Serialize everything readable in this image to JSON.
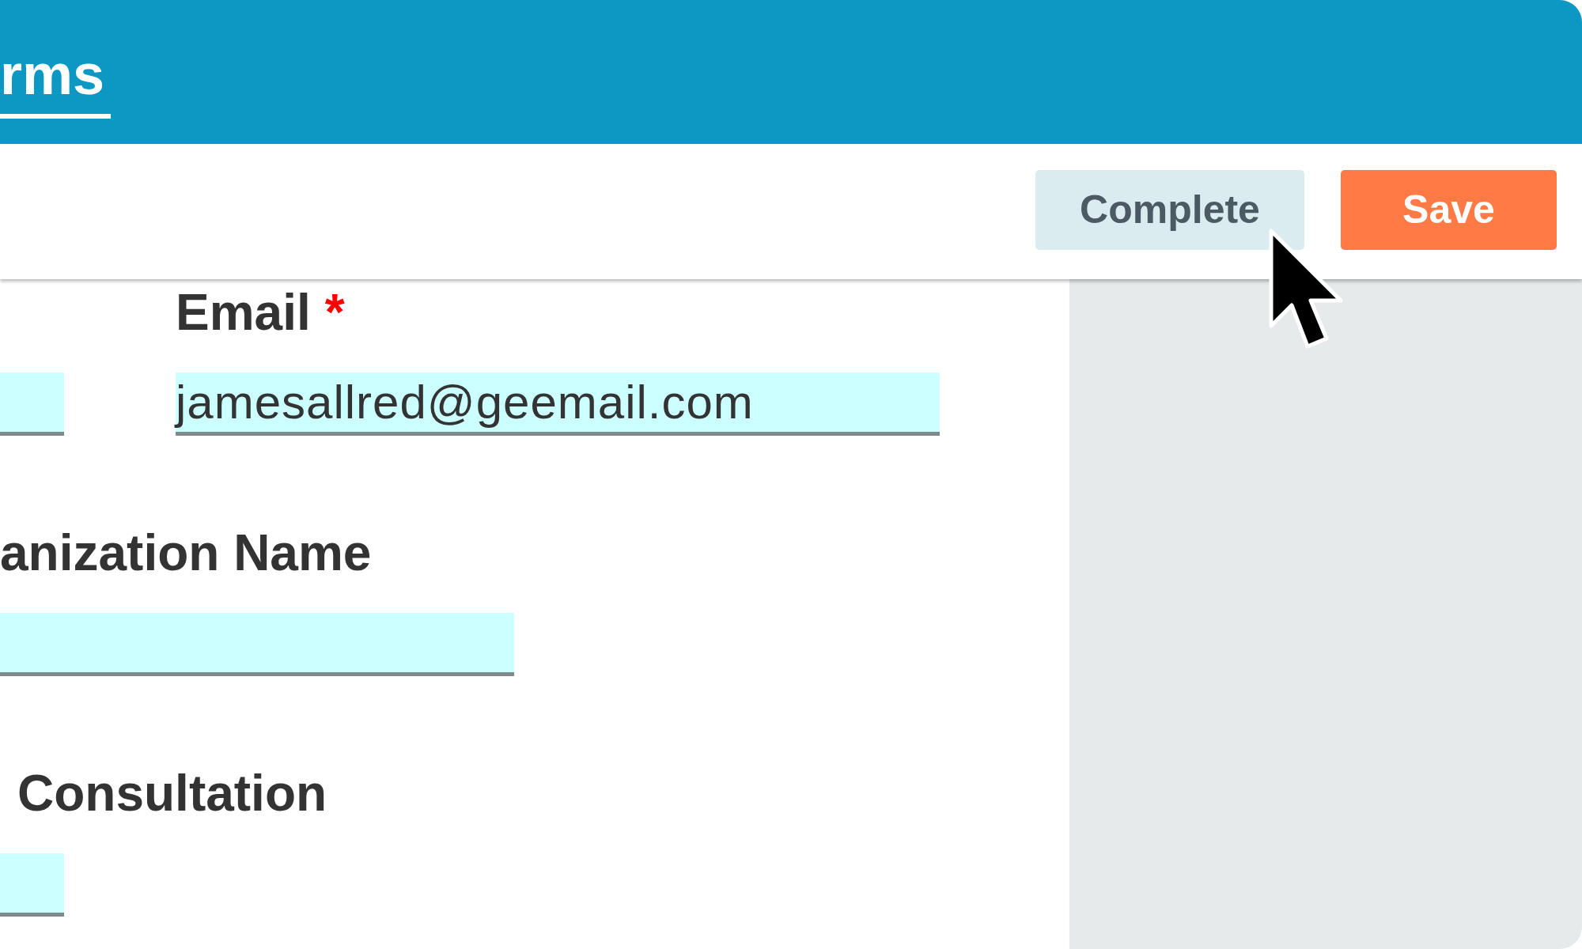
{
  "header": {
    "tabs": [
      {
        "label": "rms",
        "selected": true
      }
    ]
  },
  "toolbar": {
    "buttons": [
      {
        "label": "Complete",
        "kind": "secondary"
      },
      {
        "label": "Save",
        "kind": "primary"
      }
    ]
  },
  "form": {
    "rows": [
      {
        "fields": [
          {
            "kind": "text"
          },
          {
            "kind": "text",
            "label": "Email",
            "required_mark": "*",
            "value": "jamesallred@geemail.com"
          }
        ]
      },
      {
        "fields": [
          {
            "kind": "text",
            "label": "anization Name"
          }
        ]
      },
      {
        "fields": [
          {
            "kind": "text",
            "label": "Consultation"
          }
        ]
      }
    ]
  }
}
